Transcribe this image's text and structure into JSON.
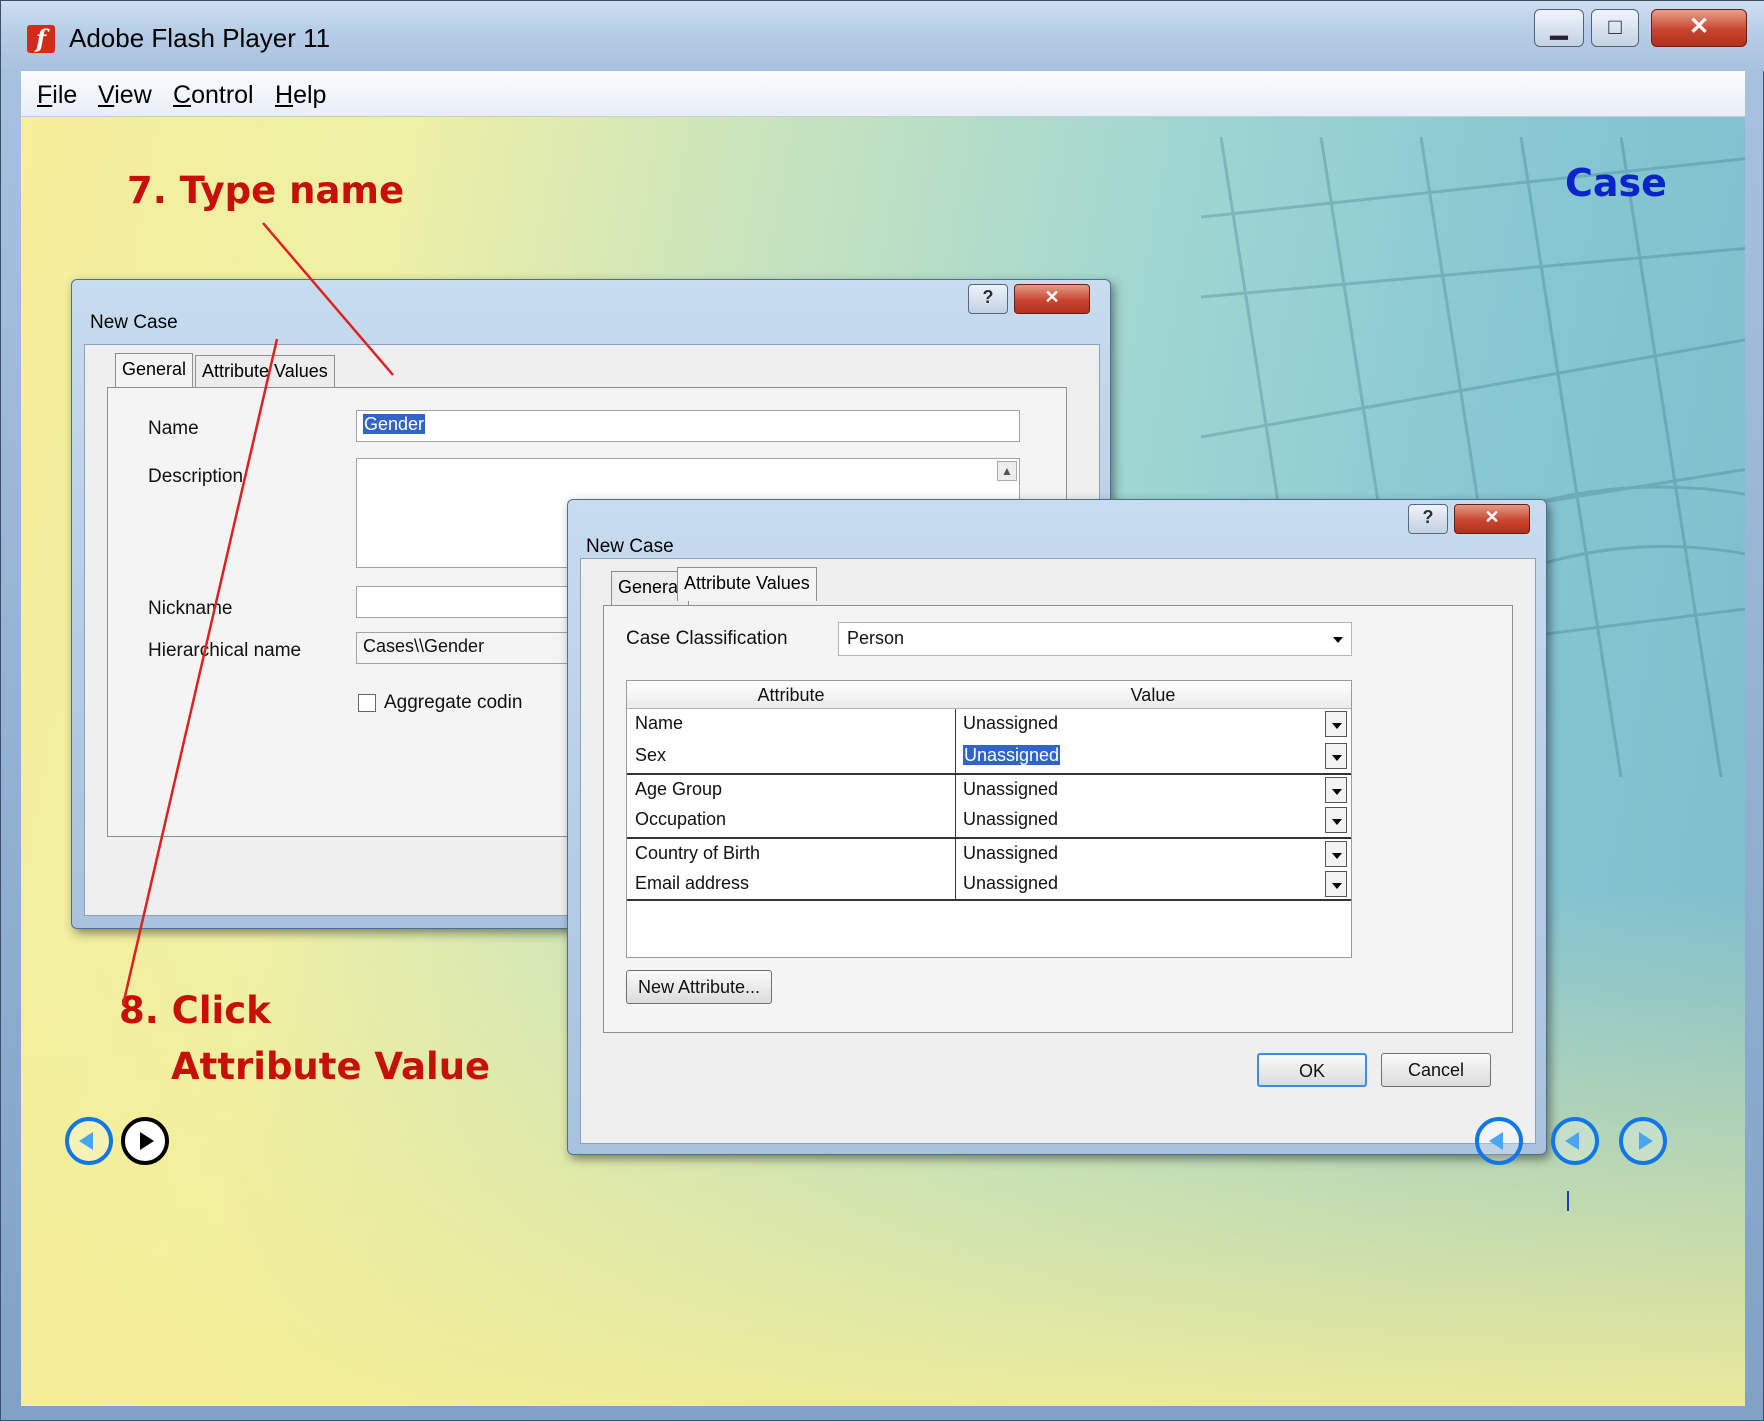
{
  "window": {
    "title": "Adobe Flash Player 11",
    "icon": "flash-icon",
    "controls": {
      "minimize": "minimize-icon",
      "maximize": "maximize-icon",
      "close": "close-icon"
    }
  },
  "menubar": {
    "items": [
      {
        "label": "File",
        "accel": "F"
      },
      {
        "label": "View",
        "accel": "V"
      },
      {
        "label": "Control",
        "accel": "C"
      },
      {
        "label": "Help",
        "accel": "H"
      }
    ]
  },
  "slide": {
    "heading": "Case",
    "annotation_1": "7. Type name",
    "annotation_2_line1": "8. Click",
    "annotation_2_line2": "Attribute Value",
    "colors": {
      "annotation": "#c8100a",
      "heading": "#0a24c8",
      "arrow": "#e02020"
    }
  },
  "dialog_back": {
    "title": "New Case",
    "tabs": {
      "general": "General",
      "attribute_values": "Attribute Values"
    },
    "fields": {
      "name_label": "Name",
      "name_value": "Gender",
      "description_label": "Description",
      "nickname_label": "Nickname",
      "hierarchical_label": "Hierarchical name",
      "hierarchical_value": "Cases\\\\Gender",
      "aggregate_label": "Aggregate codin"
    }
  },
  "dialog_front": {
    "title": "New Case",
    "tabs": {
      "general": "General",
      "attribute_values": "Attribute Values"
    },
    "classification_label": "Case Classification",
    "classification_value": "Person",
    "grid": {
      "headers": {
        "attribute": "Attribute",
        "value": "Value"
      },
      "rows": [
        {
          "attribute": "Name",
          "value": "Unassigned"
        },
        {
          "attribute": "Sex",
          "value": "Unassigned"
        },
        {
          "attribute": "Age Group",
          "value": "Unassigned"
        },
        {
          "attribute": "Occupation",
          "value": "Unassigned"
        },
        {
          "attribute": "Country of Birth",
          "value": "Unassigned"
        },
        {
          "attribute": "Email address",
          "value": "Unassigned"
        }
      ]
    },
    "new_attribute_button": "New Attribute...",
    "ok_button": "OK",
    "cancel_button": "Cancel"
  },
  "navigation": {
    "left": [
      "back-icon",
      "play-icon"
    ],
    "right": [
      "first-icon",
      "previous-icon",
      "next-icon"
    ]
  }
}
